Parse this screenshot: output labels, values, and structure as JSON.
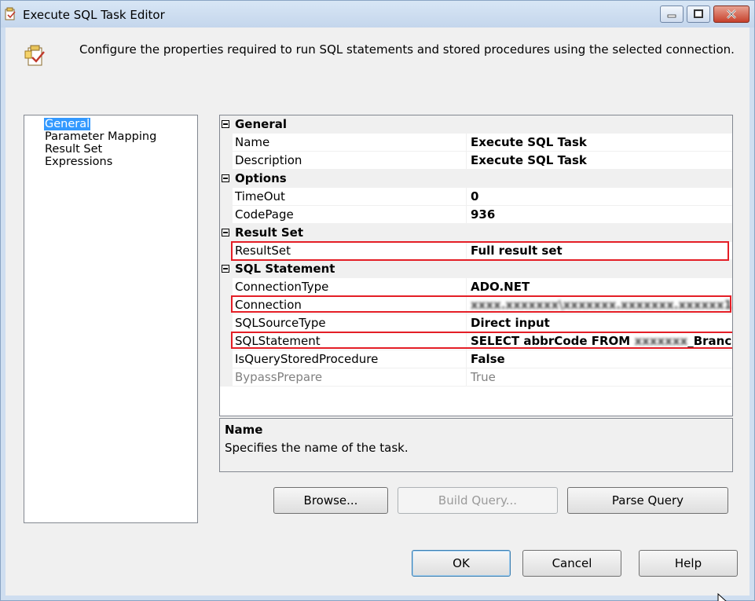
{
  "window": {
    "title": "Execute SQL Task Editor",
    "accent": "#c7412c"
  },
  "header": {
    "description": "Configure the properties required to run SQL statements and stored procedures using the selected connection."
  },
  "nav": {
    "items": [
      {
        "label": "General",
        "selected": true
      },
      {
        "label": "Parameter Mapping",
        "selected": false
      },
      {
        "label": "Result Set",
        "selected": false
      },
      {
        "label": "Expressions",
        "selected": false
      }
    ]
  },
  "grid": {
    "rows": [
      {
        "type": "category",
        "name": "General"
      },
      {
        "type": "prop",
        "name": "Name",
        "value": "Execute SQL Task"
      },
      {
        "type": "prop",
        "name": "Description",
        "value": "Execute SQL Task"
      },
      {
        "type": "category",
        "name": "Options"
      },
      {
        "type": "prop",
        "name": "TimeOut",
        "value": "0"
      },
      {
        "type": "prop",
        "name": "CodePage",
        "value": "936"
      },
      {
        "type": "category",
        "name": "Result Set"
      },
      {
        "type": "prop",
        "name": "ResultSet",
        "value": "Full result set",
        "highlighted": true
      },
      {
        "type": "category",
        "name": "SQL Statement"
      },
      {
        "type": "prop",
        "name": "ConnectionType",
        "value": "ADO.NET"
      },
      {
        "type": "prop",
        "name": "Connection",
        "value": "xxxx.xxxxxxx\\xxxxxxx.xxxxxxx.xxxxxx1",
        "highlighted": true,
        "blurred": true
      },
      {
        "type": "prop",
        "name": "SQLSourceType",
        "value": "Direct input"
      },
      {
        "type": "prop",
        "name": "SQLStatement",
        "value_prefix": "SELECT abbrCode FROM ",
        "value_blurred": "xxxxxxx",
        "value_suffix": "_Branch AS",
        "highlighted": true
      },
      {
        "type": "prop",
        "name": "IsQueryStoredProcedure",
        "value": "False"
      },
      {
        "type": "prop",
        "name": "BypassPrepare",
        "value": "True",
        "disabled": true
      }
    ],
    "highlight_color": "#e41e26"
  },
  "description_panel": {
    "title": "Name",
    "text": "Specifies the name of the task."
  },
  "buttons": {
    "browse": "Browse...",
    "build_query": "Build Query...",
    "parse_query": "Parse Query",
    "ok": "OK",
    "cancel": "Cancel",
    "help": "Help"
  }
}
